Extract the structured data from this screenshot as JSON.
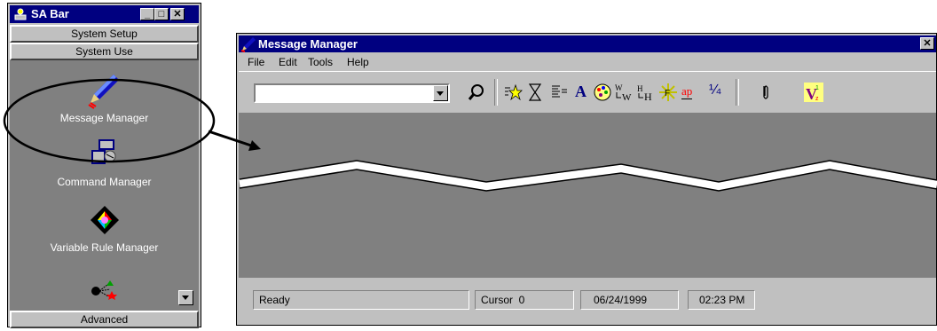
{
  "sa_bar": {
    "title": "SA Bar",
    "controls": {
      "minimize": "_",
      "maximize": "□",
      "close": "✕"
    },
    "sections": {
      "setup": "System Setup",
      "use": "System Use",
      "advanced": "Advanced"
    },
    "tools": [
      {
        "label": "Message Manager",
        "icon": "pen-icon"
      },
      {
        "label": "Command Manager",
        "icon": "command-icon"
      },
      {
        "label": "Variable Rule Manager",
        "icon": "color-diamond-icon"
      },
      {
        "label": "",
        "icon": "network-nodes-icon"
      }
    ]
  },
  "message_manager": {
    "title": "Message Manager",
    "close": "✕",
    "menu": [
      "File",
      "Edit",
      "Tools",
      "Help"
    ],
    "combo_value": "",
    "toolbar_icons": [
      "search-icon",
      "star-icon",
      "hourglass-icon",
      "align-icon",
      "font-icon",
      "palette-icon",
      "word-wrap-icon",
      "heading-icon",
      "highlight-icon",
      "ap-icon",
      "fraction-icon",
      "attachment-icon",
      "variable-icon"
    ],
    "toolbar_glyphs": {
      "font": "A",
      "ap": "ap",
      "fraction": "¼",
      "variable": "V"
    },
    "status": {
      "ready": "Ready",
      "cursor": "Cursor  0",
      "date": "06/24/1999",
      "time": "02:23 PM"
    }
  },
  "colors": {
    "titlebar": "#000080",
    "face": "#c0c0c0",
    "workspace": "#808080"
  }
}
